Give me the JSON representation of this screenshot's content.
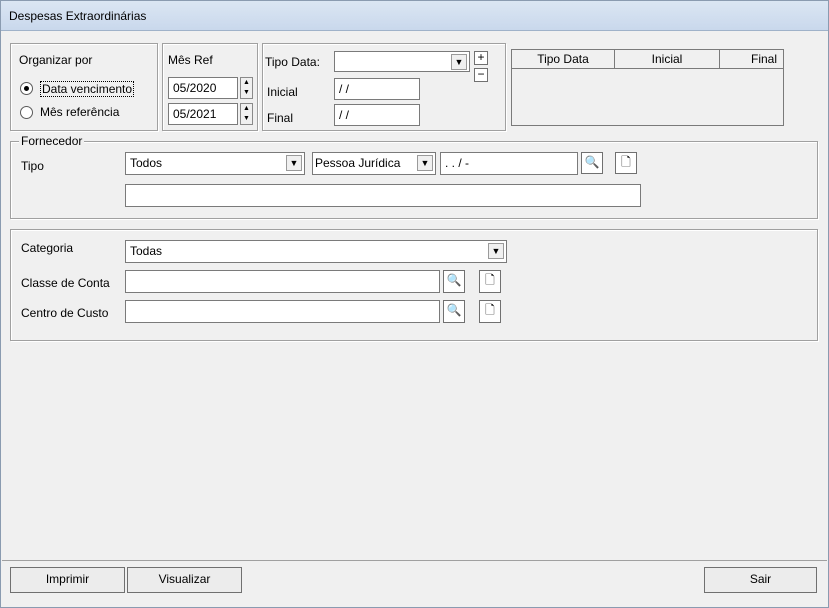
{
  "window": {
    "title": "Despesas Extraordinárias"
  },
  "organizar": {
    "label": "Organizar por",
    "options": [
      "Data vencimento",
      "Mês referência"
    ],
    "selected": 0
  },
  "mes_ref": {
    "label": "Mês Ref",
    "from": "05/2020",
    "to": "05/2021"
  },
  "tipo_data": {
    "label": "Tipo Data:",
    "value": "",
    "inicial_label": "Inicial",
    "inicial_value": " /  /",
    "final_label": "Final",
    "final_value": " /  /",
    "add": "+",
    "remove": "−"
  },
  "grid": {
    "columns": [
      "Tipo Data",
      "Inicial",
      "Final"
    ]
  },
  "fornecedor": {
    "legend": "Fornecedor",
    "tipo_label": "Tipo",
    "tipo_value": "Todos",
    "pessoa_value": "Pessoa Jurídica",
    "doc_mask": " .   .    /    -",
    "name_value": ""
  },
  "filtros": {
    "categoria_label": "Categoria",
    "categoria_value": "Todas",
    "classe_label": "Classe de Conta",
    "classe_value": "",
    "centro_label": "Centro de Custo",
    "centro_value": ""
  },
  "buttons": {
    "imprimir": "Imprimir",
    "visualizar": "Visualizar",
    "sair": "Sair"
  }
}
